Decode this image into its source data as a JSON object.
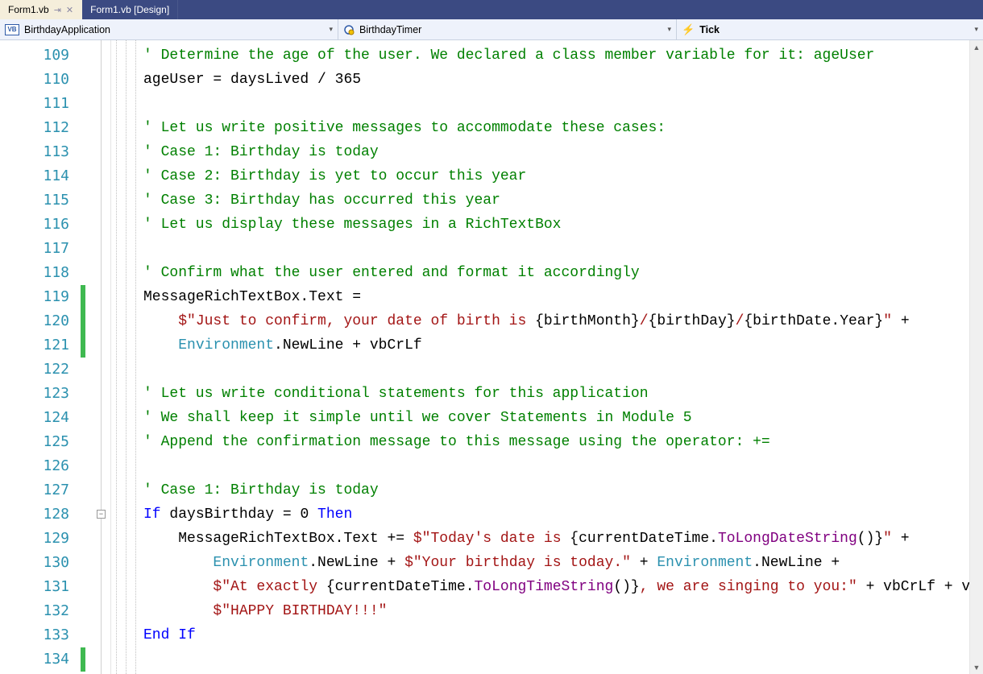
{
  "tabs": [
    {
      "label": "Form1.vb",
      "active": true,
      "pinned": true
    },
    {
      "label": "Form1.vb [Design]",
      "active": false,
      "pinned": false
    }
  ],
  "navbar": {
    "scope": "BirthdayApplication",
    "object": "BirthdayTimer",
    "member": "Tick"
  },
  "first_line": 109,
  "code_lines": [
    [
      {
        "c": "c-comment",
        "t": "' Determine the age of the user. We declared a class member variable for it: ageUser"
      }
    ],
    [
      {
        "c": "c-plain",
        "t": "ageUser = daysLived / 365"
      }
    ],
    [],
    [
      {
        "c": "c-comment",
        "t": "' Let us write positive messages to accommodate these cases:"
      }
    ],
    [
      {
        "c": "c-comment",
        "t": "' Case 1: Birthday is today"
      }
    ],
    [
      {
        "c": "c-comment",
        "t": "' Case 2: Birthday is yet to occur this year"
      }
    ],
    [
      {
        "c": "c-comment",
        "t": "' Case 3: Birthday has occurred this year"
      }
    ],
    [
      {
        "c": "c-comment",
        "t": "' Let us display these messages in a RichTextBox"
      }
    ],
    [],
    [
      {
        "c": "c-comment",
        "t": "' Confirm what the user entered and format it accordingly"
      }
    ],
    [
      {
        "c": "c-plain",
        "t": "MessageRichTextBox.Text ="
      }
    ],
    [
      {
        "c": "c-plain",
        "t": "    "
      },
      {
        "c": "c-str",
        "t": "$\"Just to confirm, your date of birth is "
      },
      {
        "c": "c-plain",
        "t": "{birthMonth}"
      },
      {
        "c": "c-str",
        "t": "/"
      },
      {
        "c": "c-plain",
        "t": "{birthDay}"
      },
      {
        "c": "c-str",
        "t": "/"
      },
      {
        "c": "c-plain",
        "t": "{birthDate.Year}"
      },
      {
        "c": "c-str",
        "t": "\""
      },
      {
        "c": "c-plain",
        "t": " +"
      }
    ],
    [
      {
        "c": "c-plain",
        "t": "    "
      },
      {
        "c": "c-type",
        "t": "Environment"
      },
      {
        "c": "c-plain",
        "t": ".NewLine + vbCrLf"
      }
    ],
    [],
    [
      {
        "c": "c-comment",
        "t": "' Let us write conditional statements for this application"
      }
    ],
    [
      {
        "c": "c-comment",
        "t": "' We shall keep it simple until we cover Statements in Module 5"
      }
    ],
    [
      {
        "c": "c-comment",
        "t": "' Append the confirmation message to this message using the operator: +="
      }
    ],
    [],
    [
      {
        "c": "c-comment",
        "t": "' Case 1: Birthday is today"
      }
    ],
    [
      {
        "c": "c-key",
        "t": "If"
      },
      {
        "c": "c-plain",
        "t": " daysBirthday = 0 "
      },
      {
        "c": "c-key",
        "t": "Then"
      }
    ],
    [
      {
        "c": "c-plain",
        "t": "    MessageRichTextBox.Text += "
      },
      {
        "c": "c-str",
        "t": "$\"Today's date is "
      },
      {
        "c": "c-plain",
        "t": "{currentDateTime."
      },
      {
        "c": "c-purple",
        "t": "ToLongDateString"
      },
      {
        "c": "c-plain",
        "t": "()}"
      },
      {
        "c": "c-str",
        "t": "\""
      },
      {
        "c": "c-plain",
        "t": " +"
      }
    ],
    [
      {
        "c": "c-plain",
        "t": "        "
      },
      {
        "c": "c-type",
        "t": "Environment"
      },
      {
        "c": "c-plain",
        "t": ".NewLine + "
      },
      {
        "c": "c-str",
        "t": "$\"Your birthday is today.\""
      },
      {
        "c": "c-plain",
        "t": " + "
      },
      {
        "c": "c-type",
        "t": "Environment"
      },
      {
        "c": "c-plain",
        "t": ".NewLine +"
      }
    ],
    [
      {
        "c": "c-plain",
        "t": "        "
      },
      {
        "c": "c-str",
        "t": "$\"At exactly "
      },
      {
        "c": "c-plain",
        "t": "{currentDateTime."
      },
      {
        "c": "c-purple",
        "t": "ToLongTimeString"
      },
      {
        "c": "c-plain",
        "t": "()}"
      },
      {
        "c": "c-str",
        "t": ", we are singing to you:\""
      },
      {
        "c": "c-plain",
        "t": " + vbCrLf + vbCrLf +"
      }
    ],
    [
      {
        "c": "c-plain",
        "t": "        "
      },
      {
        "c": "c-str",
        "t": "$\"HAPPY BIRTHDAY!!!\""
      }
    ],
    [
      {
        "c": "c-key",
        "t": "End If"
      }
    ],
    []
  ],
  "change_markers": [
    {
      "from": 119,
      "to": 121
    },
    {
      "from": 134,
      "to": 134
    }
  ],
  "fold_at": 128
}
